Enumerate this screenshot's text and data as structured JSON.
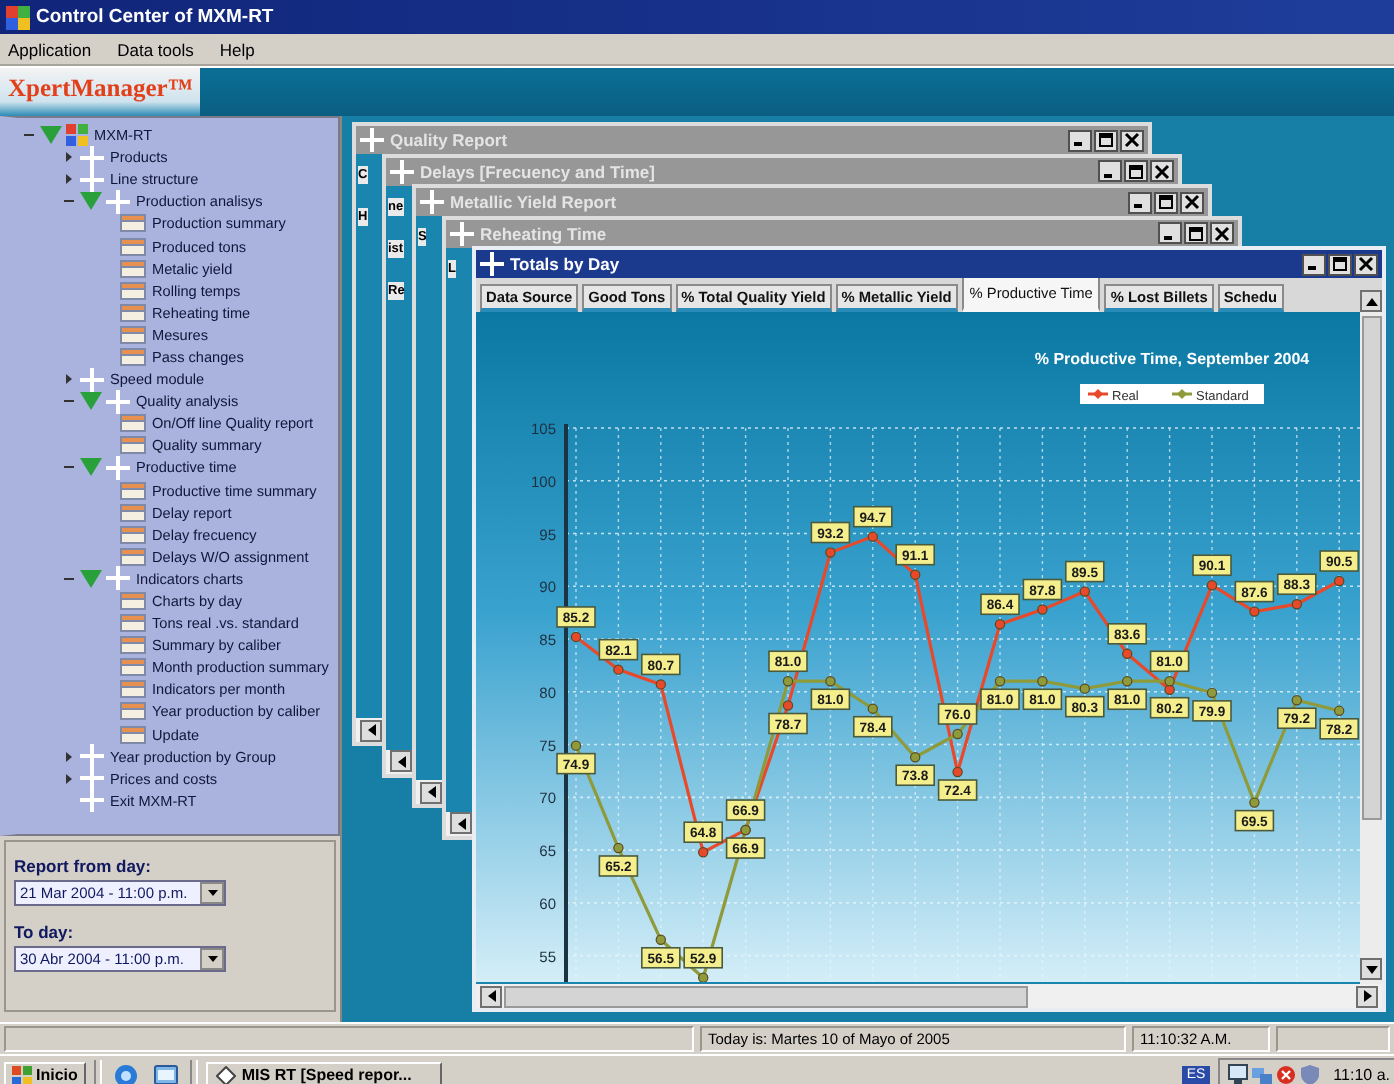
{
  "window": {
    "title": "Control Center of MXM-RT"
  },
  "menu": [
    "Application",
    "Data tools",
    "Help"
  ],
  "logo": "XpertManager™",
  "tree": [
    {
      "label": "MXM-RT",
      "kind": "root",
      "expanded": true,
      "children": [
        {
          "label": "Products",
          "kind": "folder",
          "expanded": false
        },
        {
          "label": "Line structure",
          "kind": "folder",
          "expanded": false
        },
        {
          "label": "Production analisys",
          "kind": "folder",
          "expanded": true,
          "children": [
            {
              "label": "Production summary",
              "kind": "report"
            },
            {
              "label": "Produced tons",
              "kind": "report"
            },
            {
              "label": "Metalic yield",
              "kind": "report"
            },
            {
              "label": "Rolling temps",
              "kind": "report"
            },
            {
              "label": "Reheating time",
              "kind": "report"
            },
            {
              "label": "Mesures",
              "kind": "report"
            },
            {
              "label": "Pass changes",
              "kind": "report"
            }
          ]
        },
        {
          "label": "Speed module",
          "kind": "folder",
          "expanded": false
        },
        {
          "label": "Quality analysis",
          "kind": "folder",
          "expanded": true,
          "children": [
            {
              "label": "On/Off line Quality report",
              "kind": "report"
            },
            {
              "label": "Quality summary",
              "kind": "report"
            }
          ]
        },
        {
          "label": "Productive time",
          "kind": "folder",
          "expanded": true,
          "children": [
            {
              "label": "Productive time summary",
              "kind": "report"
            },
            {
              "label": "Delay report",
              "kind": "report"
            },
            {
              "label": "Delay frecuency",
              "kind": "report"
            },
            {
              "label": "Delays W/O assignment",
              "kind": "report"
            }
          ]
        },
        {
          "label": "Indicators charts",
          "kind": "folder",
          "expanded": true,
          "children": [
            {
              "label": "Charts by day",
              "kind": "report"
            },
            {
              "label": "Tons real .vs. standard",
              "kind": "report"
            },
            {
              "label": "Summary by caliber",
              "kind": "report"
            },
            {
              "label": "Month production summary",
              "kind": "report"
            },
            {
              "label": "Indicators per month",
              "kind": "report"
            },
            {
              "label": "Year production by caliber",
              "kind": "report"
            },
            {
              "label": "Update",
              "kind": "report"
            }
          ]
        },
        {
          "label": "Year production by Group",
          "kind": "folder",
          "expanded": false
        },
        {
          "label": "Prices and costs",
          "kind": "folder",
          "expanded": false
        },
        {
          "label": "Exit MXM-RT",
          "kind": "command"
        }
      ]
    }
  ],
  "date_range": {
    "from_label": "Report from day:",
    "from_value": "21 Mar 2004 - 11:00 p.m.",
    "to_label": "To day:",
    "to_value": "30 Abr 2004 - 11:00 p.m."
  },
  "windows": [
    {
      "title": "Quality Report",
      "active": false,
      "fragments": [
        "C",
        "H"
      ]
    },
    {
      "title": "Delays [Frecuency and Time]",
      "active": false,
      "fragments": [
        "ne",
        "ist",
        "Re"
      ]
    },
    {
      "title": "Metallic Yield Report",
      "active": false,
      "fragments": [
        "S"
      ]
    },
    {
      "title": "Reheating Time",
      "active": false,
      "fragments": [
        "L"
      ]
    },
    {
      "title": "Totals by Day",
      "active": true,
      "tabs": [
        {
          "label": "Data Source",
          "selected": false
        },
        {
          "label": "Good Tons",
          "selected": false
        },
        {
          "label": "% Total Quality Yield",
          "selected": false
        },
        {
          "label": "% Metallic Yield",
          "selected": false
        },
        {
          "label": "% Productive Time",
          "selected": true
        },
        {
          "label": "% Lost Billets",
          "selected": false
        },
        {
          "label": "Schedu",
          "selected": false
        }
      ],
      "chart_data": {
        "type": "line",
        "title": "% Productive Time, September 2004",
        "ylim": [
          52.5,
          105
        ],
        "yticks": [
          55,
          60,
          65,
          70,
          75,
          80,
          85,
          90,
          95,
          100,
          105
        ],
        "grid": true,
        "legend": true,
        "series": [
          {
            "name": "Real",
            "color": "#e8492a",
            "marker": "circle",
            "values": [
              85.2,
              82.1,
              80.7,
              64.8,
              66.9,
              78.7,
              93.2,
              94.7,
              91.1,
              72.4,
              86.4,
              87.8,
              89.5,
              83.6,
              80.2,
              90.1,
              87.6,
              88.3,
              90.5
            ],
            "value_labels": [
              "85.2",
              "82.1",
              "80.7",
              "64.8",
              "66.9",
              "78.7",
              "93.2",
              "94.7",
              "91.1",
              "72.4",
              "86.4",
              "87.8",
              "89.5",
              "83.6",
              "80.2",
              "90.1",
              "87.6",
              "88.3",
              "90.5"
            ]
          },
          {
            "name": "Standard",
            "color": "#8f9a3a",
            "marker": "circle",
            "values": [
              74.9,
              65.2,
              56.5,
              52.9,
              66.9,
              81.0,
              81.0,
              78.4,
              73.8,
              76.0,
              81.0,
              81.0,
              80.3,
              81.0,
              81.0,
              79.9,
              69.5,
              79.2,
              78.2
            ],
            "value_labels": [
              "74.9",
              "65.2",
              "56.5",
              "52.9",
              "66.9",
              "81.0",
              "81.0",
              "78.4",
              "73.8",
              "76.0",
              "81.0",
              "81.0",
              "80.3",
              "81.0",
              "81.0",
              "79.9",
              "69.5",
              "79.2",
              "78.2"
            ]
          }
        ]
      }
    }
  ],
  "status_bar": {
    "today": "Today is:  Martes 10 of Mayo of 2005",
    "time": "11:10:32 A.M."
  },
  "taskbar": {
    "start": "Inicio",
    "tasks": [
      {
        "label": "MIS RT  [Speed repor...",
        "selected": false
      }
    ],
    "language": "ES",
    "clock": "11:10 a."
  }
}
